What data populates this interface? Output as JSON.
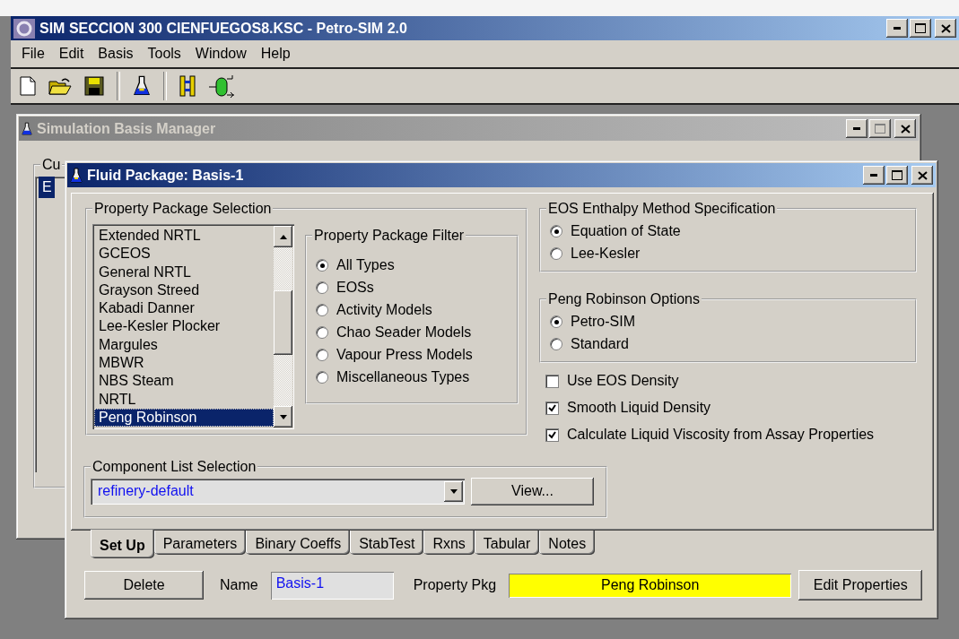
{
  "app_window": {
    "title": "SIM SECCION 300 CIENFUEGOS8.KSC - Petro-SIM 2.0",
    "active": true
  },
  "menu": [
    "File",
    "Edit",
    "Basis",
    "Tools",
    "Window",
    "Help"
  ],
  "basis_manager": {
    "title": "Simulation Basis Manager",
    "active": false,
    "group_label": "Cu",
    "list_items": [
      {
        "label": "E",
        "selected": true
      }
    ]
  },
  "fluid_package": {
    "title": "Fluid Package: Basis-1",
    "active": true,
    "property_package_selection": {
      "label": "Property Package Selection",
      "items": [
        {
          "label": "Extended NRTL",
          "selected": false
        },
        {
          "label": "GCEOS",
          "selected": false
        },
        {
          "label": "General NRTL",
          "selected": false
        },
        {
          "label": "Grayson Streed",
          "selected": false
        },
        {
          "label": "Kabadi Danner",
          "selected": false
        },
        {
          "label": "Lee-Kesler Plocker",
          "selected": false
        },
        {
          "label": "Margules",
          "selected": false
        },
        {
          "label": "MBWR",
          "selected": false
        },
        {
          "label": "NBS Steam",
          "selected": false
        },
        {
          "label": "NRTL",
          "selected": false
        },
        {
          "label": "Peng Robinson",
          "selected": true
        }
      ]
    },
    "property_package_filter": {
      "label": "Property Package Filter",
      "options": [
        {
          "label": "All Types",
          "selected": true
        },
        {
          "label": "EOSs",
          "selected": false
        },
        {
          "label": "Activity Models",
          "selected": false
        },
        {
          "label": "Chao Seader Models",
          "selected": false
        },
        {
          "label": "Vapour Press Models",
          "selected": false
        },
        {
          "label": "Miscellaneous Types",
          "selected": false
        }
      ]
    },
    "eos_enthalpy": {
      "label": "EOS Enthalpy Method Specification",
      "options": [
        {
          "label": "Equation of State",
          "selected": true
        },
        {
          "label": "Lee-Kesler",
          "selected": false
        }
      ]
    },
    "peng_robinson_options": {
      "label": "Peng Robinson Options",
      "options": [
        {
          "label": "Petro-SIM",
          "selected": true
        },
        {
          "label": "Standard",
          "selected": false
        }
      ]
    },
    "checkboxes": [
      {
        "label": "Use EOS Density",
        "checked": false
      },
      {
        "label": "Smooth Liquid Density",
        "checked": true
      },
      {
        "label": "Calculate Liquid Viscosity from Assay Properties",
        "checked": true
      }
    ],
    "component_list": {
      "label": "Component List Selection",
      "value": "refinery-default",
      "button": "View..."
    },
    "tabs": [
      {
        "label": "Set Up",
        "selected": true
      },
      {
        "label": "Parameters",
        "selected": false
      },
      {
        "label": "Binary Coeffs",
        "selected": false
      },
      {
        "label": "StabTest",
        "selected": false
      },
      {
        "label": "Rxns",
        "selected": false
      },
      {
        "label": "Tabular",
        "selected": false
      },
      {
        "label": "Notes",
        "selected": false
      }
    ],
    "delete_button": "Delete",
    "name": {
      "label": "Name",
      "value": "Basis-1"
    },
    "property_pkg": {
      "label": "Property Pkg",
      "value": "Peng Robinson"
    },
    "edit_button": "Edit Properties"
  }
}
